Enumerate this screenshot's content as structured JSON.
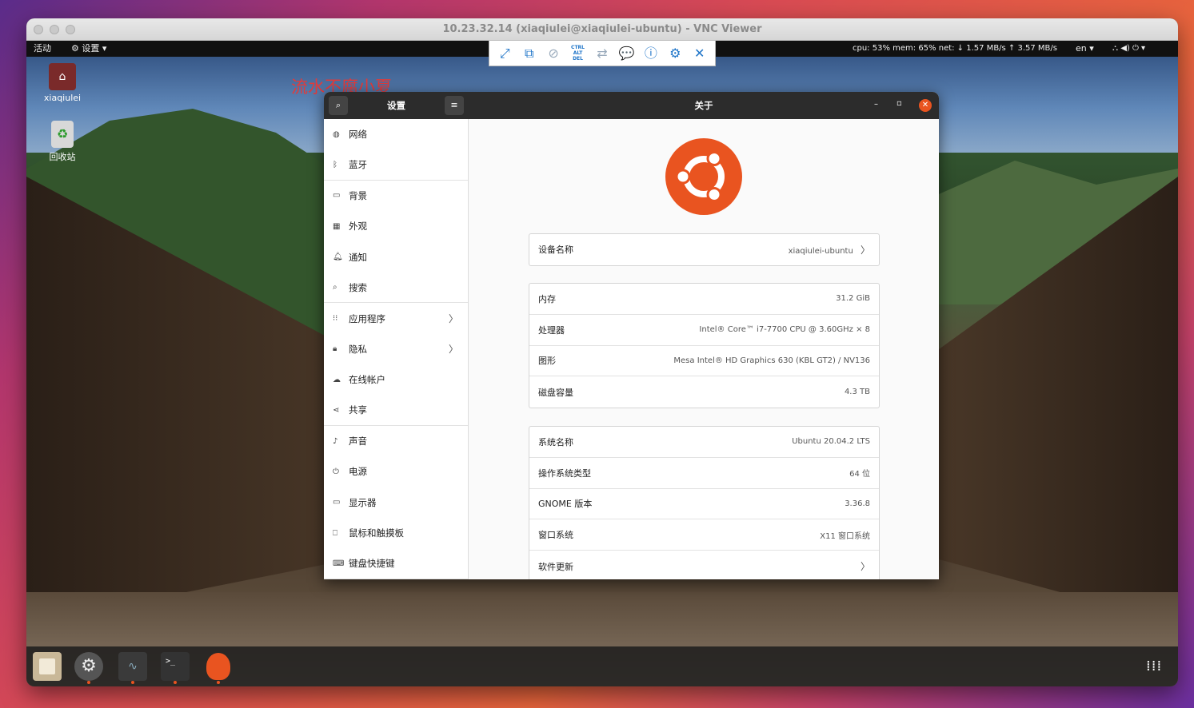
{
  "mac_title": "10.23.32.14 (xiaqiulei@xiaqiulei-ubuntu) - VNC Viewer",
  "topbar": {
    "activities": "活动",
    "app_menu": "设置",
    "stats": "cpu: 53% mem: 65% net: ↓ 1.57 MB/s ↑ 3.57 MB/s",
    "lang": "en"
  },
  "desktop": {
    "home_label": "xiaqiulei",
    "trash_label": "回收站"
  },
  "vnc_toolbar": {
    "ctrl_alt_del": "CTRL ALT DEL"
  },
  "watermark": "流水不腐小夏",
  "settings": {
    "sidebar_title": "设置",
    "panel_title": "关于",
    "sidebar": [
      {
        "label": "网络",
        "icon": "network-icon"
      },
      {
        "label": "蓝牙",
        "icon": "bluetooth-icon"
      },
      {
        "label": "背景",
        "icon": "background-icon"
      },
      {
        "label": "外观",
        "icon": "appearance-icon"
      },
      {
        "label": "通知",
        "icon": "bell-icon"
      },
      {
        "label": "搜索",
        "icon": "search-icon"
      },
      {
        "label": "应用程序",
        "icon": "apps-grid-icon"
      },
      {
        "label": "隐私",
        "icon": "lock-icon"
      },
      {
        "label": "在线帐户",
        "icon": "cloud-icon"
      },
      {
        "label": "共享",
        "icon": "share-icon"
      },
      {
        "label": "声音",
        "icon": "music-note-icon"
      },
      {
        "label": "电源",
        "icon": "power-icon"
      },
      {
        "label": "显示器",
        "icon": "display-icon"
      },
      {
        "label": "鼠标和触摸板",
        "icon": "mouse-icon"
      },
      {
        "label": "键盘快捷键",
        "icon": "keyboard-icon"
      }
    ],
    "device": {
      "label": "设备名称",
      "value": "xiaqiulei-ubuntu"
    },
    "hardware": [
      {
        "label": "内存",
        "value": "31.2 GiB"
      },
      {
        "label": "处理器",
        "value": "Intel® Core™ i7-7700 CPU @ 3.60GHz × 8"
      },
      {
        "label": "图形",
        "value": "Mesa Intel® HD Graphics 630 (KBL GT2) / NV136"
      },
      {
        "label": "磁盘容量",
        "value": "4.3 TB"
      }
    ],
    "software": [
      {
        "label": "系统名称",
        "value": "Ubuntu 20.04.2 LTS"
      },
      {
        "label": "操作系统类型",
        "value": "64 位"
      },
      {
        "label": "GNOME 版本",
        "value": "3.36.8"
      },
      {
        "label": "窗口系统",
        "value": "X11 窗口系统"
      },
      {
        "label": "软件更新",
        "value": ""
      }
    ]
  },
  "colors": {
    "ubuntu_orange": "#e95420"
  }
}
